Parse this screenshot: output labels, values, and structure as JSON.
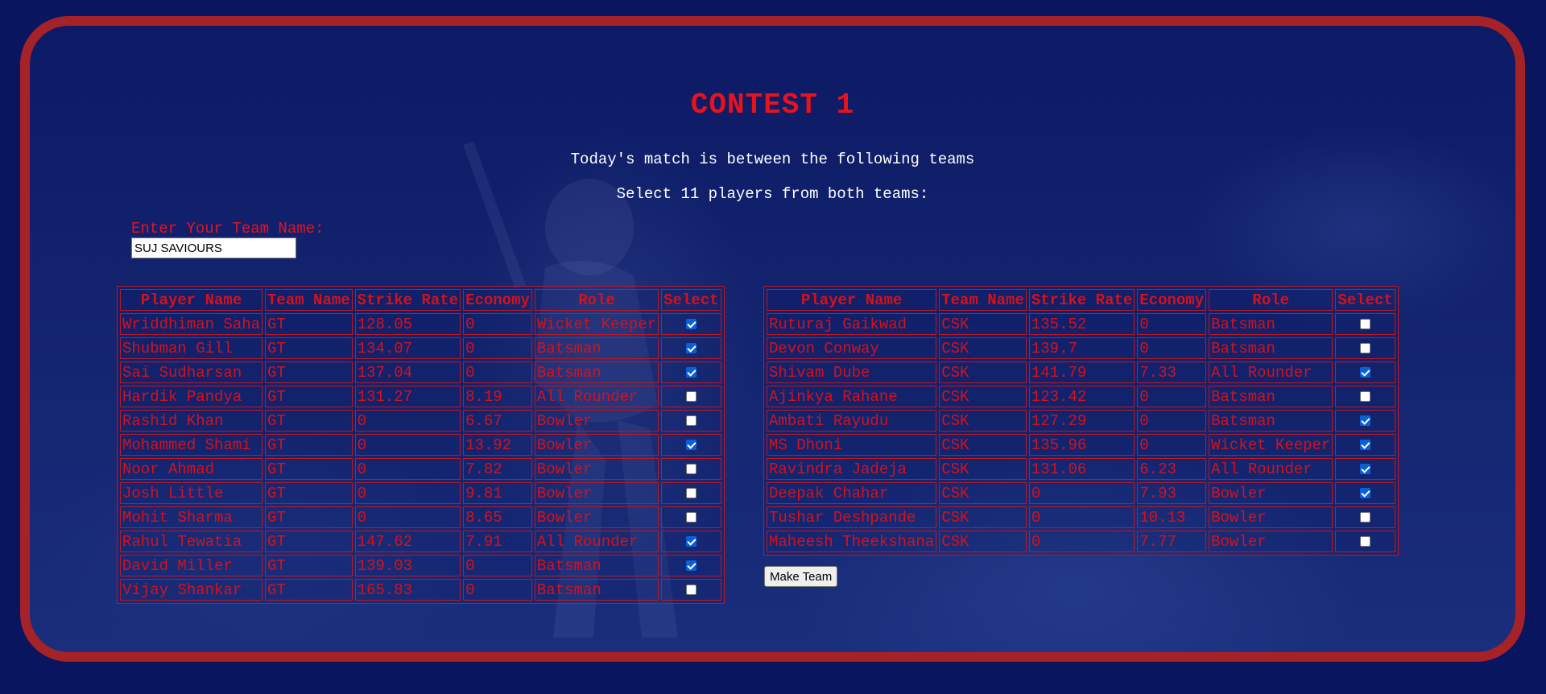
{
  "title": "CONTEST 1",
  "subtitle_match": "Today's match is between the following teams",
  "subtitle_select": "Select 11 players from both teams:",
  "team_name_label": "Enter Your Team Name:",
  "team_name_value": "SUJ SAVIOURS",
  "columns": [
    "Player Name",
    "Team Name",
    "Strike Rate",
    "Economy",
    "Role",
    "Select"
  ],
  "left_table": [
    {
      "name": "Wriddhiman Saha",
      "team": "GT",
      "strike_rate": "128.05",
      "economy": "0",
      "role": "Wicket Keeper",
      "selected": true
    },
    {
      "name": "Shubman Gill",
      "team": "GT",
      "strike_rate": "134.07",
      "economy": "0",
      "role": "Batsman",
      "selected": true
    },
    {
      "name": "Sai Sudharsan",
      "team": "GT",
      "strike_rate": "137.04",
      "economy": "0",
      "role": "Batsman",
      "selected": true
    },
    {
      "name": "Hardik Pandya",
      "team": "GT",
      "strike_rate": "131.27",
      "economy": "8.19",
      "role": "All Rounder",
      "selected": false
    },
    {
      "name": "Rashid Khan",
      "team": "GT",
      "strike_rate": "0",
      "economy": "6.67",
      "role": "Bowler",
      "selected": false
    },
    {
      "name": "Mohammed Shami",
      "team": "GT",
      "strike_rate": "0",
      "economy": "13.92",
      "role": "Bowler",
      "selected": true
    },
    {
      "name": "Noor Ahmad",
      "team": "GT",
      "strike_rate": "0",
      "economy": "7.82",
      "role": "Bowler",
      "selected": false
    },
    {
      "name": "Josh Little",
      "team": "GT",
      "strike_rate": "0",
      "economy": "9.81",
      "role": "Bowler",
      "selected": false
    },
    {
      "name": "Mohit Sharma",
      "team": "GT",
      "strike_rate": "0",
      "economy": "8.65",
      "role": "Bowler",
      "selected": false
    },
    {
      "name": "Rahul Tewatia",
      "team": "GT",
      "strike_rate": "147.62",
      "economy": "7.91",
      "role": "All Rounder",
      "selected": true
    },
    {
      "name": "David Miller",
      "team": "GT",
      "strike_rate": "139.03",
      "economy": "0",
      "role": "Batsman",
      "selected": true
    },
    {
      "name": "Vijay Shankar",
      "team": "GT",
      "strike_rate": "165.83",
      "economy": "0",
      "role": "Batsman",
      "selected": false
    }
  ],
  "right_table": [
    {
      "name": "Ruturaj Gaikwad",
      "team": "CSK",
      "strike_rate": "135.52",
      "economy": "0",
      "role": "Batsman",
      "selected": false
    },
    {
      "name": "Devon Conway",
      "team": "CSK",
      "strike_rate": "139.7",
      "economy": "0",
      "role": "Batsman",
      "selected": false
    },
    {
      "name": "Shivam Dube",
      "team": "CSK",
      "strike_rate": "141.79",
      "economy": "7.33",
      "role": "All Rounder",
      "selected": true
    },
    {
      "name": "Ajinkya Rahane",
      "team": "CSK",
      "strike_rate": "123.42",
      "economy": "0",
      "role": "Batsman",
      "selected": false
    },
    {
      "name": "Ambati Rayudu",
      "team": "CSK",
      "strike_rate": "127.29",
      "economy": "0",
      "role": "Batsman",
      "selected": true
    },
    {
      "name": "MS Dhoni",
      "team": "CSK",
      "strike_rate": "135.96",
      "economy": "0",
      "role": "Wicket Keeper",
      "selected": true
    },
    {
      "name": "Ravindra Jadeja",
      "team": "CSK",
      "strike_rate": "131.06",
      "economy": "6.23",
      "role": "All Rounder",
      "selected": true
    },
    {
      "name": "Deepak Chahar",
      "team": "CSK",
      "strike_rate": "0",
      "economy": "7.93",
      "role": "Bowler",
      "selected": true
    },
    {
      "name": "Tushar Deshpande",
      "team": "CSK",
      "strike_rate": "0",
      "economy": "10.13",
      "role": "Bowler",
      "selected": false
    },
    {
      "name": "Maheesh Theekshana",
      "team": "CSK",
      "strike_rate": "0",
      "economy": "7.77",
      "role": "Bowler",
      "selected": false
    }
  ],
  "make_team_label": "Make Team",
  "colors": {
    "page_background": "#0a1560",
    "frame_border": "#a52228",
    "accent_red": "#e8121c",
    "checkbox_checked": "#0b60d8"
  }
}
